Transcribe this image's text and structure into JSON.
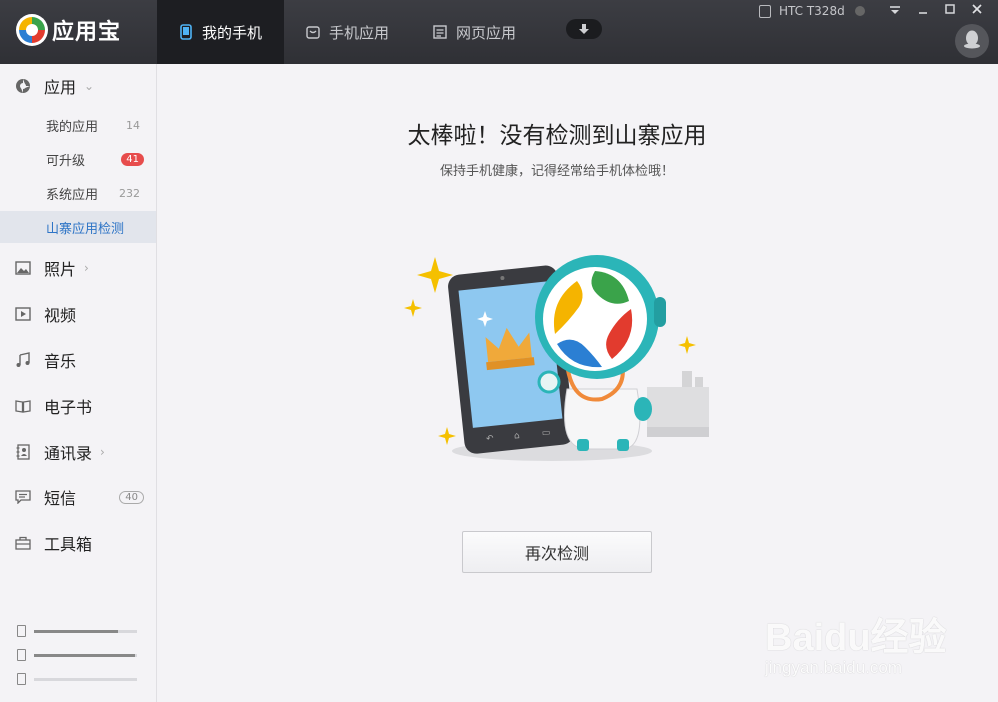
{
  "app": {
    "logo_text": "应用宝"
  },
  "tabs": [
    {
      "label": "我的手机",
      "icon": "phone-icon",
      "active": true
    },
    {
      "label": "手机应用",
      "icon": "bag-icon",
      "active": false
    },
    {
      "label": "网页应用",
      "icon": "doc-icon",
      "active": false
    }
  ],
  "device": {
    "name": "HTC T328d"
  },
  "sidebar": {
    "app_category": {
      "label": "应用",
      "icon": "apps-icon"
    },
    "app_items": [
      {
        "label": "我的应用",
        "count": "14"
      },
      {
        "label": "可升级",
        "badge": "41"
      },
      {
        "label": "系统应用",
        "count": "232"
      },
      {
        "label": "山寨应用检测",
        "active": true
      }
    ],
    "categories": [
      {
        "label": "照片",
        "icon": "photo-icon"
      },
      {
        "label": "视频",
        "icon": "video-icon"
      },
      {
        "label": "音乐",
        "icon": "music-icon"
      },
      {
        "label": "电子书",
        "icon": "book-icon"
      },
      {
        "label": "通讯录",
        "icon": "contacts-icon"
      },
      {
        "label": "短信",
        "icon": "sms-icon",
        "badge": "40"
      },
      {
        "label": "工具箱",
        "icon": "toolbox-icon"
      }
    ],
    "storage": [
      {
        "icon": "phone-storage-icon",
        "fraction": 0.82
      },
      {
        "icon": "sdcard-icon",
        "fraction": 0.98
      },
      {
        "icon": "sdcard2-icon",
        "fraction": 0.0
      }
    ]
  },
  "main": {
    "title": "太棒啦！没有检测到山寨应用",
    "subtitle": "保持手机健康，记得经常给手机体检哦！",
    "button_label": "再次检测"
  },
  "watermark": {
    "text": "Baidu经验",
    "url": "jingyan.baidu.com"
  },
  "colors": {
    "accent": "#2d74c6",
    "badge_red": "#e74c4c",
    "topbar": "#35363b"
  }
}
